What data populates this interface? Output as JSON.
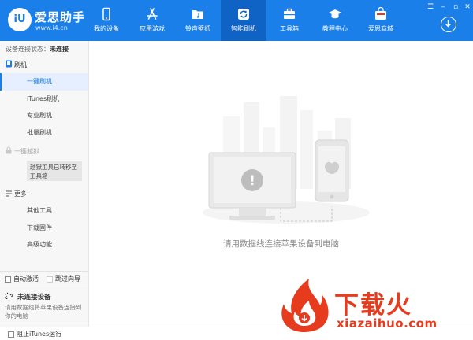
{
  "header": {
    "app_name": "爱思助手",
    "app_url": "www.i4.cn",
    "logo_text": "iU",
    "nav": [
      {
        "label": "我的设备",
        "icon": "phone-icon"
      },
      {
        "label": "应用游戏",
        "icon": "app-store-icon"
      },
      {
        "label": "铃声壁纸",
        "icon": "music-folder-icon"
      },
      {
        "label": "智能刷机",
        "icon": "refresh-box-icon",
        "active": true
      },
      {
        "label": "工具箱",
        "icon": "toolbox-icon"
      },
      {
        "label": "教程中心",
        "icon": "graduation-cap-icon"
      },
      {
        "label": "爱思商城",
        "icon": "shopping-box-icon"
      }
    ],
    "active_color": "#0f63c5",
    "brand_color": "#1a7fe8"
  },
  "sidebar": {
    "status_label": "设备连接状态：",
    "status_value": "未连接",
    "flash_section": "刷机",
    "flash_items": [
      "一键刷机",
      "iTunes刷机",
      "专业刷机",
      "批量刷机"
    ],
    "jailbreak_section": "一键越狱",
    "jailbreak_notice": "越狱工具已转移至工具箱",
    "more_section": "更多",
    "more_items": [
      "其他工具",
      "下载固件",
      "高级功能"
    ],
    "auto_activate": "自动激活",
    "skip_guide": "跳过向导",
    "device_title": "未连接设备",
    "device_desc": "请用数据线将苹果设备连接到你的电脑"
  },
  "bottom": {
    "block_itunes": "阻止iTunes运行"
  },
  "main": {
    "empty_message": "请用数据线连接苹果设备到电脑",
    "device_alert_symbol": "!"
  },
  "watermark": {
    "brand": "下载火",
    "url": "xiazaihuo.com"
  }
}
